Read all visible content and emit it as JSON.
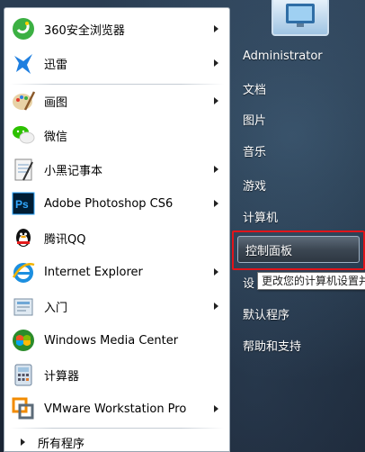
{
  "start_menu": {
    "programs": [
      {
        "label": "360安全浏览器",
        "icon": "360-browser-icon",
        "has_arrow": true
      },
      {
        "label": "迅雷",
        "icon": "xunlei-icon",
        "has_arrow": true
      },
      {
        "label": "画图",
        "icon": "paint-icon",
        "has_arrow": true
      },
      {
        "label": "微信",
        "icon": "wechat-icon",
        "has_arrow": false
      },
      {
        "label": "小黑记事本",
        "icon": "notepad-icon",
        "has_arrow": true
      },
      {
        "label": "Adobe Photoshop CS6",
        "icon": "photoshop-icon",
        "has_arrow": true
      },
      {
        "label": "腾讯QQ",
        "icon": "qq-icon",
        "has_arrow": false
      },
      {
        "label": "Internet Explorer",
        "icon": "ie-icon",
        "has_arrow": true
      },
      {
        "label": "入门",
        "icon": "getting-started-icon",
        "has_arrow": true
      },
      {
        "label": "Windows Media Center",
        "icon": "media-center-icon",
        "has_arrow": false
      },
      {
        "label": "计算器",
        "icon": "calculator-icon",
        "has_arrow": false
      },
      {
        "label": "VMware Workstation Pro",
        "icon": "vmware-icon",
        "has_arrow": true
      }
    ],
    "all_programs": "所有程序",
    "ps_text": "Ps",
    "right_items": [
      {
        "label": "Administrator"
      },
      {
        "label": "文档"
      },
      {
        "label": "图片"
      },
      {
        "label": "音乐"
      },
      {
        "label": "游戏"
      },
      {
        "label": "计算机"
      },
      {
        "label": "控制面板"
      },
      {
        "label": "设"
      },
      {
        "label": "默认程序"
      },
      {
        "label": "帮助和支持"
      }
    ],
    "tooltip": "更改您的计算机设置并",
    "accent_red": "#e0141a"
  }
}
